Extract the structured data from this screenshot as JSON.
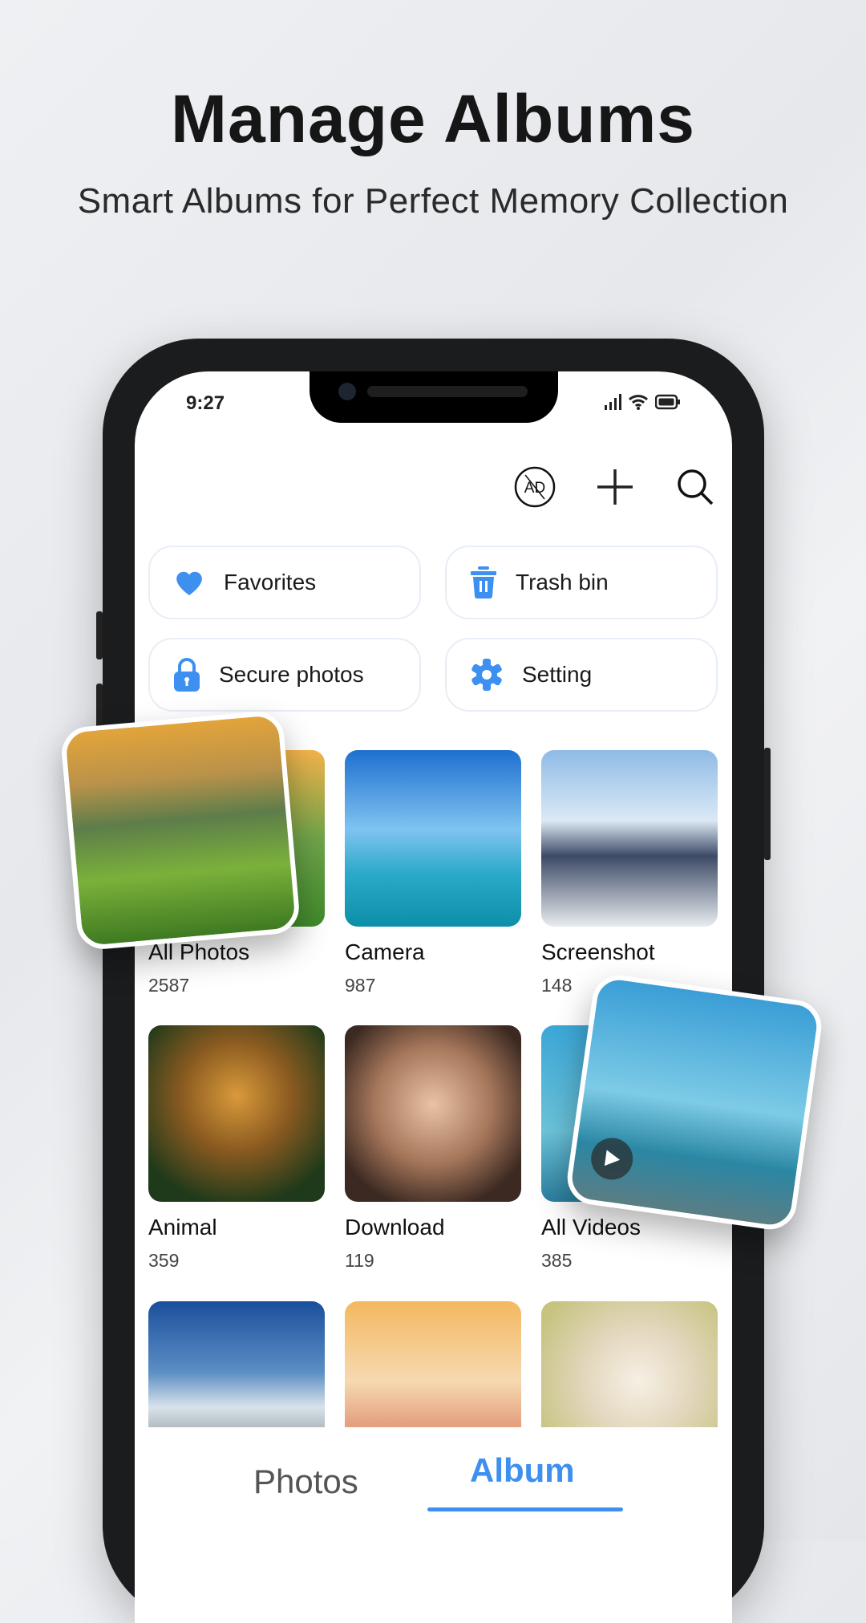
{
  "header": {
    "title": "Manage Albums",
    "subtitle": "Smart Albums for Perfect Memory Collection"
  },
  "status_bar": {
    "time": "9:27",
    "icons": [
      "signal-icon",
      "wifi-icon",
      "battery-icon"
    ]
  },
  "toolbar": {
    "icons": [
      "no-ads-icon",
      "plus-icon",
      "search-icon"
    ],
    "no_ads_text": "AD"
  },
  "quick_actions": [
    {
      "label": "Favorites",
      "icon": "heart-icon"
    },
    {
      "label": "Trash bin",
      "icon": "trash-icon"
    },
    {
      "label": "Secure photos",
      "icon": "lock-icon"
    },
    {
      "label": "Setting",
      "icon": "gear-icon"
    }
  ],
  "albums": [
    {
      "name": "All Photos",
      "count": "2587"
    },
    {
      "name": "Camera",
      "count": "987"
    },
    {
      "name": "Screenshot",
      "count": "148"
    },
    {
      "name": "Animal",
      "count": "359"
    },
    {
      "name": "Download",
      "count": "119"
    },
    {
      "name": "All Videos",
      "count": "385"
    }
  ],
  "bottom_nav": {
    "tabs": [
      {
        "label": "Photos",
        "active": false
      },
      {
        "label": "Album",
        "active": true
      }
    ]
  },
  "colors": {
    "accent": "#3d8ff0",
    "text": "#111111"
  }
}
